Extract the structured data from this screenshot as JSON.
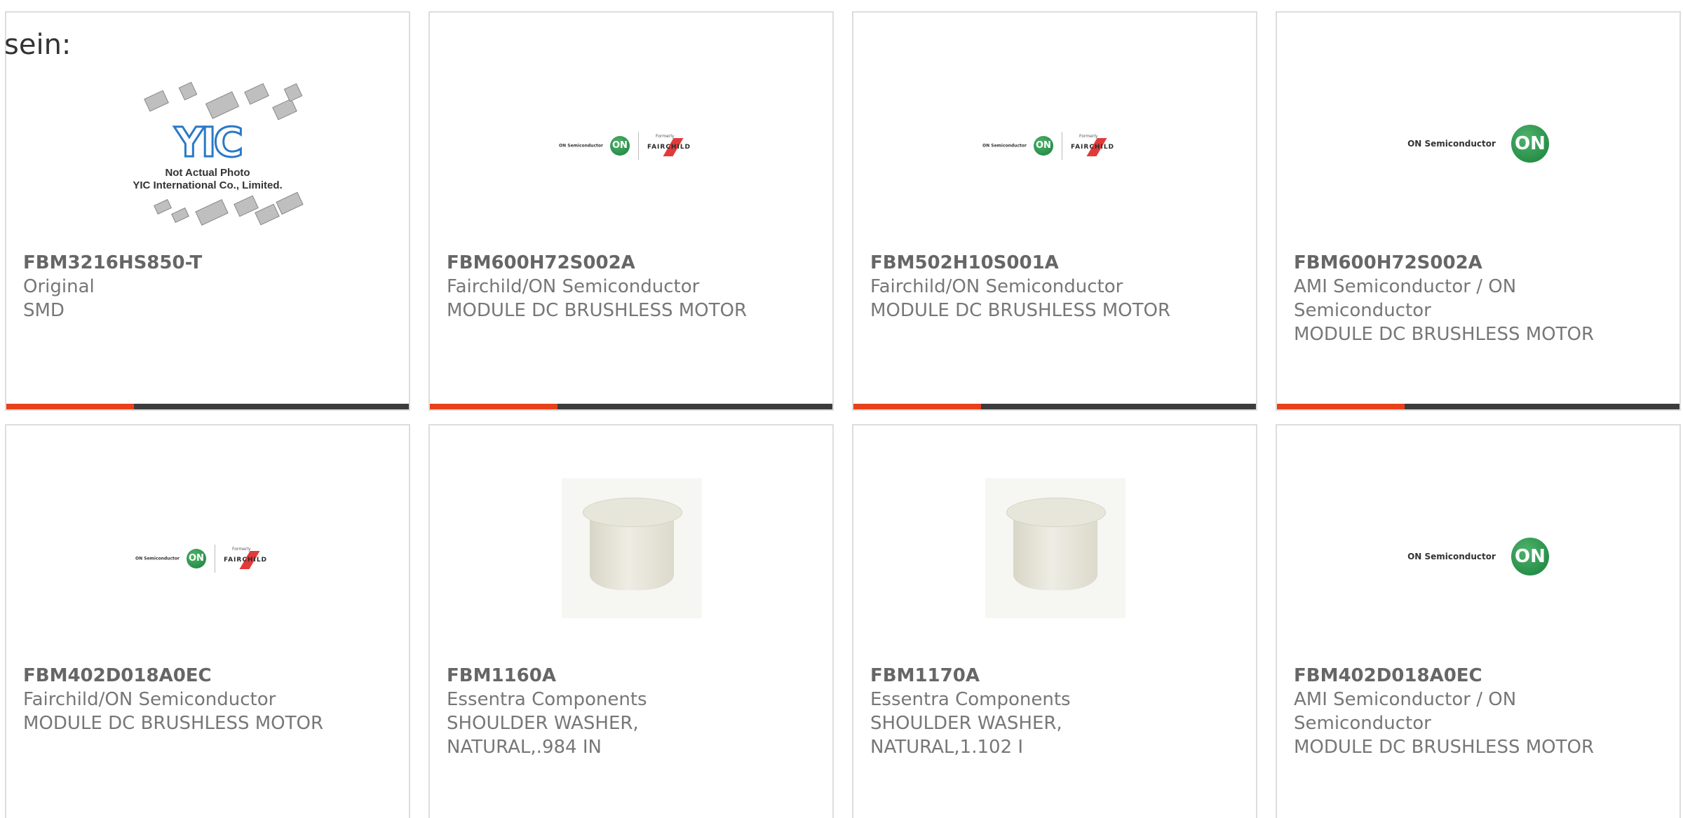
{
  "intro_text": "sein:",
  "yic_graphic": {
    "logo": "YIC",
    "caption_line1": "Not Actual Photo",
    "caption_line2": "YIC International Co., Limited."
  },
  "on_logo": {
    "text": "ON Semiconductor",
    "circle": "ON",
    "formerly": "Formerly",
    "fairchild": "FAIRCHILD"
  },
  "colors": {
    "accent_bar": "#e8411a",
    "dark_bar": "#3c3c3c",
    "on_green": "#17803b"
  },
  "products": [
    {
      "part": "FBM3216HS850-T",
      "manufacturer": "Original",
      "description": "SMD",
      "image": "yic-placeholder"
    },
    {
      "part": "FBM600H72S002A",
      "manufacturer": "Fairchild/ON Semiconductor",
      "description": "MODULE DC BRUSHLESS MOTOR",
      "image": "on-fairchild-logo"
    },
    {
      "part": "FBM502H10S001A",
      "manufacturer": "Fairchild/ON Semiconductor",
      "description": "MODULE DC BRUSHLESS MOTOR",
      "image": "on-fairchild-logo"
    },
    {
      "part": "FBM600H72S002A",
      "manufacturer_line1": "AMI Semiconductor / ON",
      "manufacturer_line2": "Semiconductor",
      "description": "MODULE DC BRUSHLESS MOTOR",
      "image": "on-semi-logo"
    },
    {
      "part": "FBM402D018A0EC",
      "manufacturer": "Fairchild/ON Semiconductor",
      "description": "MODULE DC BRUSHLESS MOTOR",
      "image": "on-fairchild-logo"
    },
    {
      "part": "FBM1160A",
      "manufacturer": "Essentra Components",
      "description_line1": "SHOULDER WASHER,",
      "description_line2": "NATURAL,.984 IN",
      "image": "washer-photo"
    },
    {
      "part": "FBM1170A",
      "manufacturer": "Essentra Components",
      "description_line1": "SHOULDER WASHER,",
      "description_line2": "NATURAL,1.102 I",
      "image": "washer-photo"
    },
    {
      "part": "FBM402D018A0EC",
      "manufacturer_line1": "AMI Semiconductor / ON",
      "manufacturer_line2": "Semiconductor",
      "description": "MODULE DC BRUSHLESS MOTOR",
      "image": "on-semi-logo"
    }
  ]
}
